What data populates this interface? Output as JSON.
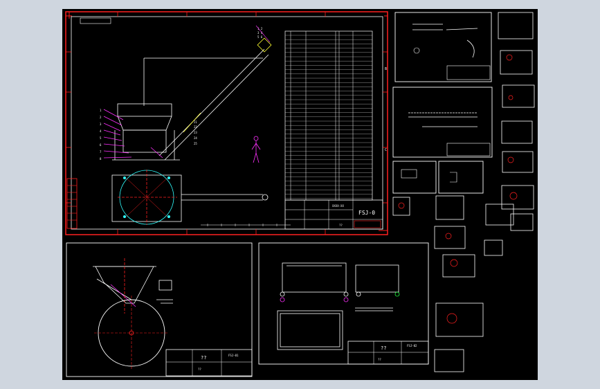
{
  "viewer": {
    "background_color": "#cfd6df",
    "canvas_color": "#000000"
  },
  "colors": {
    "line": "#ffffff",
    "frame_red": "#ff2020",
    "accent_magenta": "#ff30ff",
    "accent_cyan": "#30ffff",
    "accent_green": "#20ff40",
    "accent_yellow": "#ffff30"
  },
  "main_sheet": {
    "drawing_code": "FSJ-0",
    "title_block": {
      "code_small": "XXXX-XX",
      "qty": "??",
      "signature": "??"
    }
  },
  "sheet_hopper": {
    "title": "??",
    "code": "FSJ-01",
    "note": "??"
  },
  "sheet_frame": {
    "title": "??",
    "code": "FSJ-02",
    "note": "??"
  },
  "side_labels": {
    "zone_left": "A",
    "zone_right": "B",
    "letter_d": "D",
    "letter_c": "C"
  }
}
